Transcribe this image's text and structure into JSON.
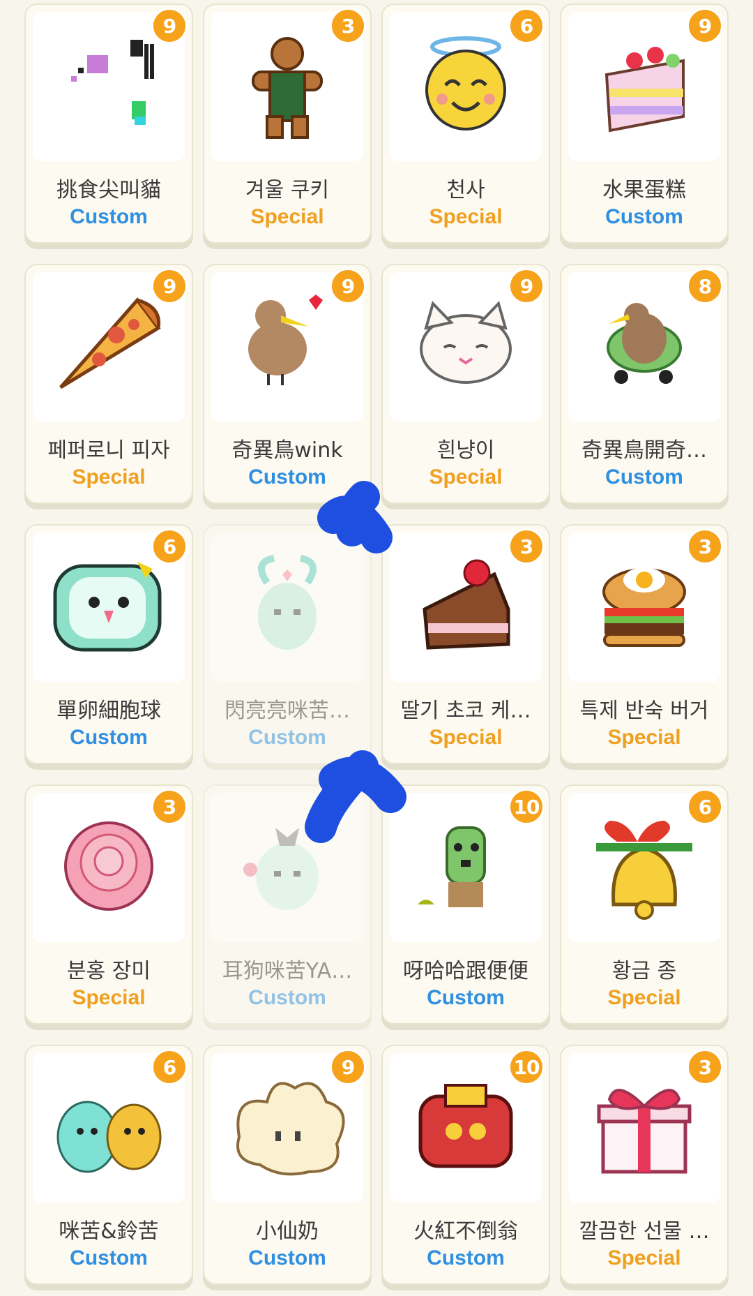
{
  "items": [
    {
      "name": "挑食尖叫貓",
      "type": "Custom",
      "badge": "9",
      "icon": "screaming-cat-icon",
      "dim": false
    },
    {
      "name": "겨울 쿠키",
      "type": "Special",
      "badge": "3",
      "icon": "gingerbread-cookie-icon",
      "dim": false
    },
    {
      "name": "천사",
      "type": "Special",
      "badge": "6",
      "icon": "angel-face-icon",
      "dim": false
    },
    {
      "name": "水果蛋糕",
      "type": "Custom",
      "badge": "9",
      "icon": "fruit-cake-icon",
      "dim": false
    },
    {
      "name": "페퍼로니 피자",
      "type": "Special",
      "badge": "9",
      "icon": "pizza-slice-icon",
      "dim": false
    },
    {
      "name": "奇異鳥wink",
      "type": "Custom",
      "badge": "9",
      "icon": "kiwi-bird-heart-icon",
      "dim": false
    },
    {
      "name": "흰냥이",
      "type": "Special",
      "badge": "9",
      "icon": "white-cat-icon",
      "dim": false
    },
    {
      "name": "奇異鳥開奇…",
      "type": "Custom",
      "badge": "8",
      "icon": "kiwi-bird-car-icon",
      "dim": false
    },
    {
      "name": "單卵細胞球",
      "type": "Custom",
      "badge": "6",
      "icon": "green-blob-icon",
      "dim": false
    },
    {
      "name": "閃亮亮咪苦…",
      "type": "Custom",
      "badge": "",
      "icon": "bunny-heart-icon",
      "dim": true
    },
    {
      "name": "딸기 초코 케…",
      "type": "Special",
      "badge": "3",
      "icon": "chocolate-cake-icon",
      "dim": false
    },
    {
      "name": "특제 반숙 버거",
      "type": "Special",
      "badge": "3",
      "icon": "burger-icon",
      "dim": false
    },
    {
      "name": "분홍 장미",
      "type": "Special",
      "badge": "3",
      "icon": "pink-rose-icon",
      "dim": false
    },
    {
      "name": "耳狗咪苦YA…",
      "type": "Custom",
      "badge": "",
      "icon": "bunny-bow-icon",
      "dim": true
    },
    {
      "name": "呀哈哈跟便便",
      "type": "Custom",
      "badge": "10",
      "icon": "cactus-creature-icon",
      "dim": false
    },
    {
      "name": "황금 종",
      "type": "Special",
      "badge": "6",
      "icon": "golden-bell-icon",
      "dim": false
    },
    {
      "name": "咪苦&鈴苦",
      "type": "Custom",
      "badge": "6",
      "icon": "twin-creatures-icon",
      "dim": false
    },
    {
      "name": "小仙奶",
      "type": "Custom",
      "badge": "9",
      "icon": "cream-blob-icon",
      "dim": false
    },
    {
      "name": "火紅不倒翁",
      "type": "Custom",
      "badge": "10",
      "icon": "red-daruma-icon",
      "dim": false
    },
    {
      "name": "깔끔한 선물 …",
      "type": "Special",
      "badge": "3",
      "icon": "gift-box-icon",
      "dim": false
    }
  ],
  "colors": {
    "custom": "#2f8fe0",
    "special": "#f0a020",
    "badge": "#f6a21a",
    "marker": "#1e4fe0"
  }
}
